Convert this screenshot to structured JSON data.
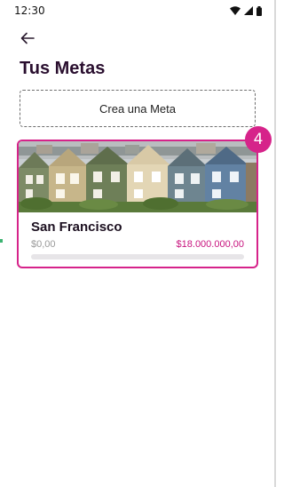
{
  "status_bar": {
    "time": "12:30",
    "icons": [
      "wifi-icon",
      "signal-icon",
      "battery-icon"
    ]
  },
  "header": {
    "back_icon": "arrow-left-icon",
    "title": "Tus Metas"
  },
  "create_goal": {
    "label": "Crea una Meta"
  },
  "goals": [
    {
      "name": "San Francisco",
      "current": "$0,00",
      "target": "$18.000.000,00",
      "progress": 0,
      "image": "painted-ladies-houses"
    }
  ],
  "badge": {
    "count": "4"
  },
  "colors": {
    "accent": "#d6238a",
    "title": "#2a0f2f",
    "track": "#e7e5e8"
  }
}
